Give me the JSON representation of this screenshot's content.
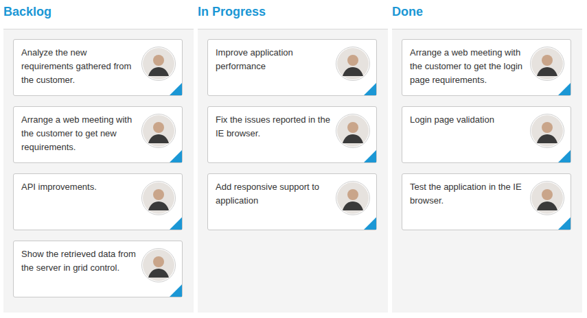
{
  "board": {
    "columns": [
      {
        "title": "Backlog",
        "cards": [
          {
            "text": "Analyze the new requirements gathered from the customer."
          },
          {
            "text": "Arrange a web meeting with the customer to get new requirements."
          },
          {
            "text": "API improvements."
          },
          {
            "text": "Show the retrieved data from the server in grid control."
          }
        ]
      },
      {
        "title": "In Progress",
        "cards": [
          {
            "text": "Improve application performance"
          },
          {
            "text": "Fix the issues reported in the IE browser."
          },
          {
            "text": "Add responsive support to application"
          }
        ]
      },
      {
        "title": "Done",
        "cards": [
          {
            "text": "Arrange a web meeting with the customer to get the login page requirements."
          },
          {
            "text": "Login page validation"
          },
          {
            "text": "Test the application in the IE browser."
          }
        ]
      }
    ]
  }
}
